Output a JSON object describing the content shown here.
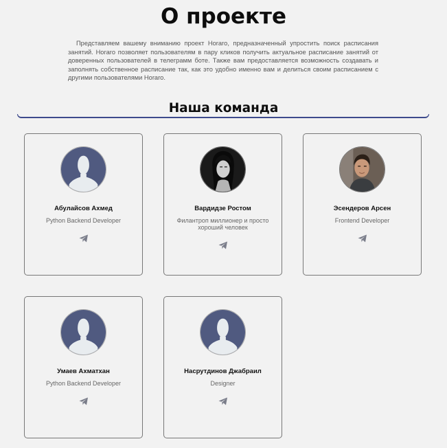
{
  "page": {
    "title": "О проекте",
    "intro": "Представляем вашему вниманию проект Horaro, предназначенный упростить поиск расписания занятий. Horaro позволяет пользователям в пару кликов получить актуальное расписание занятий от доверенных пользователей в телеграмм боте. Также вам предоставляется возможность создавать и заполнять собственное расписание так, как это удобно именно вам и делиться своим расписанием с другими пользователями Horaro."
  },
  "team": {
    "heading": "Наша команда",
    "members": [
      {
        "name": "Абулайсов Ахмед",
        "role": "Python Backend Developer",
        "avatar": "default-avatar-icon",
        "link_icon": "telegram-icon"
      },
      {
        "name": "Вардидзе Ростом",
        "role": "Филантроп миллионер и просто хороший человек",
        "avatar": "photo-dark",
        "link_icon": "telegram-icon"
      },
      {
        "name": "Эсендеров Арсен",
        "role": "Frontend Developer",
        "avatar": "photo-light",
        "link_icon": "telegram-icon"
      },
      {
        "name": "Умаев Ахматхан",
        "role": "Python Backend Developer",
        "avatar": "default-avatar-icon",
        "link_icon": "telegram-icon"
      },
      {
        "name": "Насрутдинов Джабраил",
        "role": "Designer",
        "avatar": "default-avatar-icon",
        "link_icon": "telegram-icon"
      }
    ]
  },
  "colors": {
    "background": "#f2f2f2",
    "accent_underline": "#3d4a8c",
    "avatar_bg": "#505a80",
    "avatar_silhouette": "#e8ecef",
    "icon_gray": "#7a7d8a"
  }
}
